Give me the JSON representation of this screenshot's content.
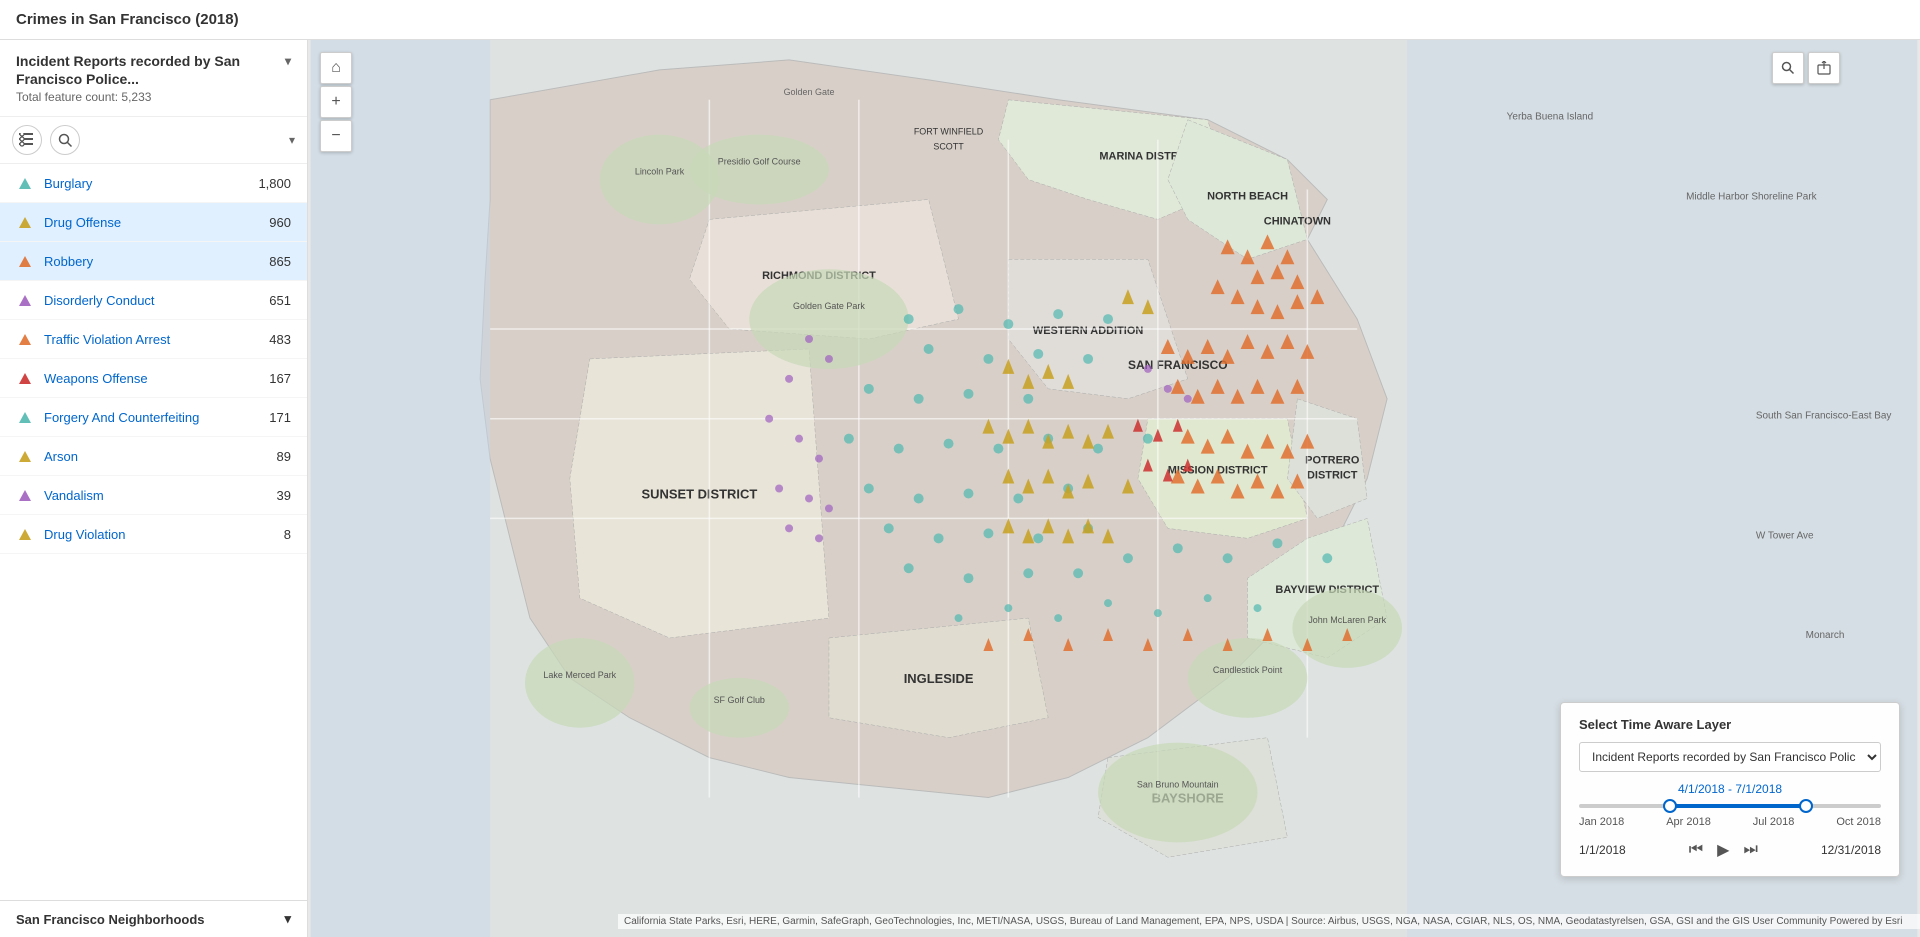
{
  "title": "Crimes in San Francisco (2018)",
  "sidebar": {
    "layer_title": "Incident Reports recorded by San Francisco Police...",
    "layer_count_label": "Total feature count: 5,233",
    "crimes": [
      {
        "id": "burglary",
        "name": "Burglary",
        "count": "1,800",
        "icon": "triangle-teal",
        "selected": false
      },
      {
        "id": "drug-offense",
        "name": "Drug Offense",
        "count": "960",
        "icon": "triangle-yellow",
        "selected": true
      },
      {
        "id": "robbery",
        "name": "Robbery",
        "count": "865",
        "icon": "triangle-orange",
        "selected": true
      },
      {
        "id": "disorderly-conduct",
        "name": "Disorderly Conduct",
        "count": "651",
        "icon": "triangle-purple",
        "selected": false
      },
      {
        "id": "traffic-violation-arrest",
        "name": "Traffic Violation Arrest",
        "count": "483",
        "icon": "triangle-orange",
        "selected": false
      },
      {
        "id": "weapons-offense",
        "name": "Weapons Offense",
        "count": "167",
        "icon": "triangle-red",
        "selected": false
      },
      {
        "id": "forgery-counterfeiting",
        "name": "Forgery And Counterfeiting",
        "count": "171",
        "icon": "triangle-teal",
        "selected": false
      },
      {
        "id": "arson",
        "name": "Arson",
        "count": "89",
        "icon": "triangle-yellow",
        "selected": false
      },
      {
        "id": "vandalism",
        "name": "Vandalism",
        "count": "39",
        "icon": "triangle-purple",
        "selected": false
      },
      {
        "id": "drug-violation",
        "name": "Drug Violation",
        "count": "8",
        "icon": "triangle-yellow",
        "selected": false
      }
    ],
    "section_label": "San Francisco Neighborhoods"
  },
  "time_panel": {
    "title": "Select Time Aware Layer",
    "layer_option": "Incident Reports recorded by San Francisco Police",
    "date_range": "4/1/2018 - 7/1/2018",
    "axis_labels": [
      "Jan 2018",
      "Apr 2018",
      "Jul 2018",
      "Oct 2018"
    ],
    "start_date": "1/1/2018",
    "end_date": "12/31/2018"
  },
  "attribution": "California State Parks, Esri, HERE, Garmin, SafeGraph, GeoTechnologies, Inc, METI/NASA, USGS, Bureau of Land Management, EPA, NPS, USDA | Source: Airbus, USGS, NGA, NASA, CGIAR, NLS, OS, NMA, Geodatastyrelsen, GSA, GSI and the GIS User Community   Powered by Esri"
}
